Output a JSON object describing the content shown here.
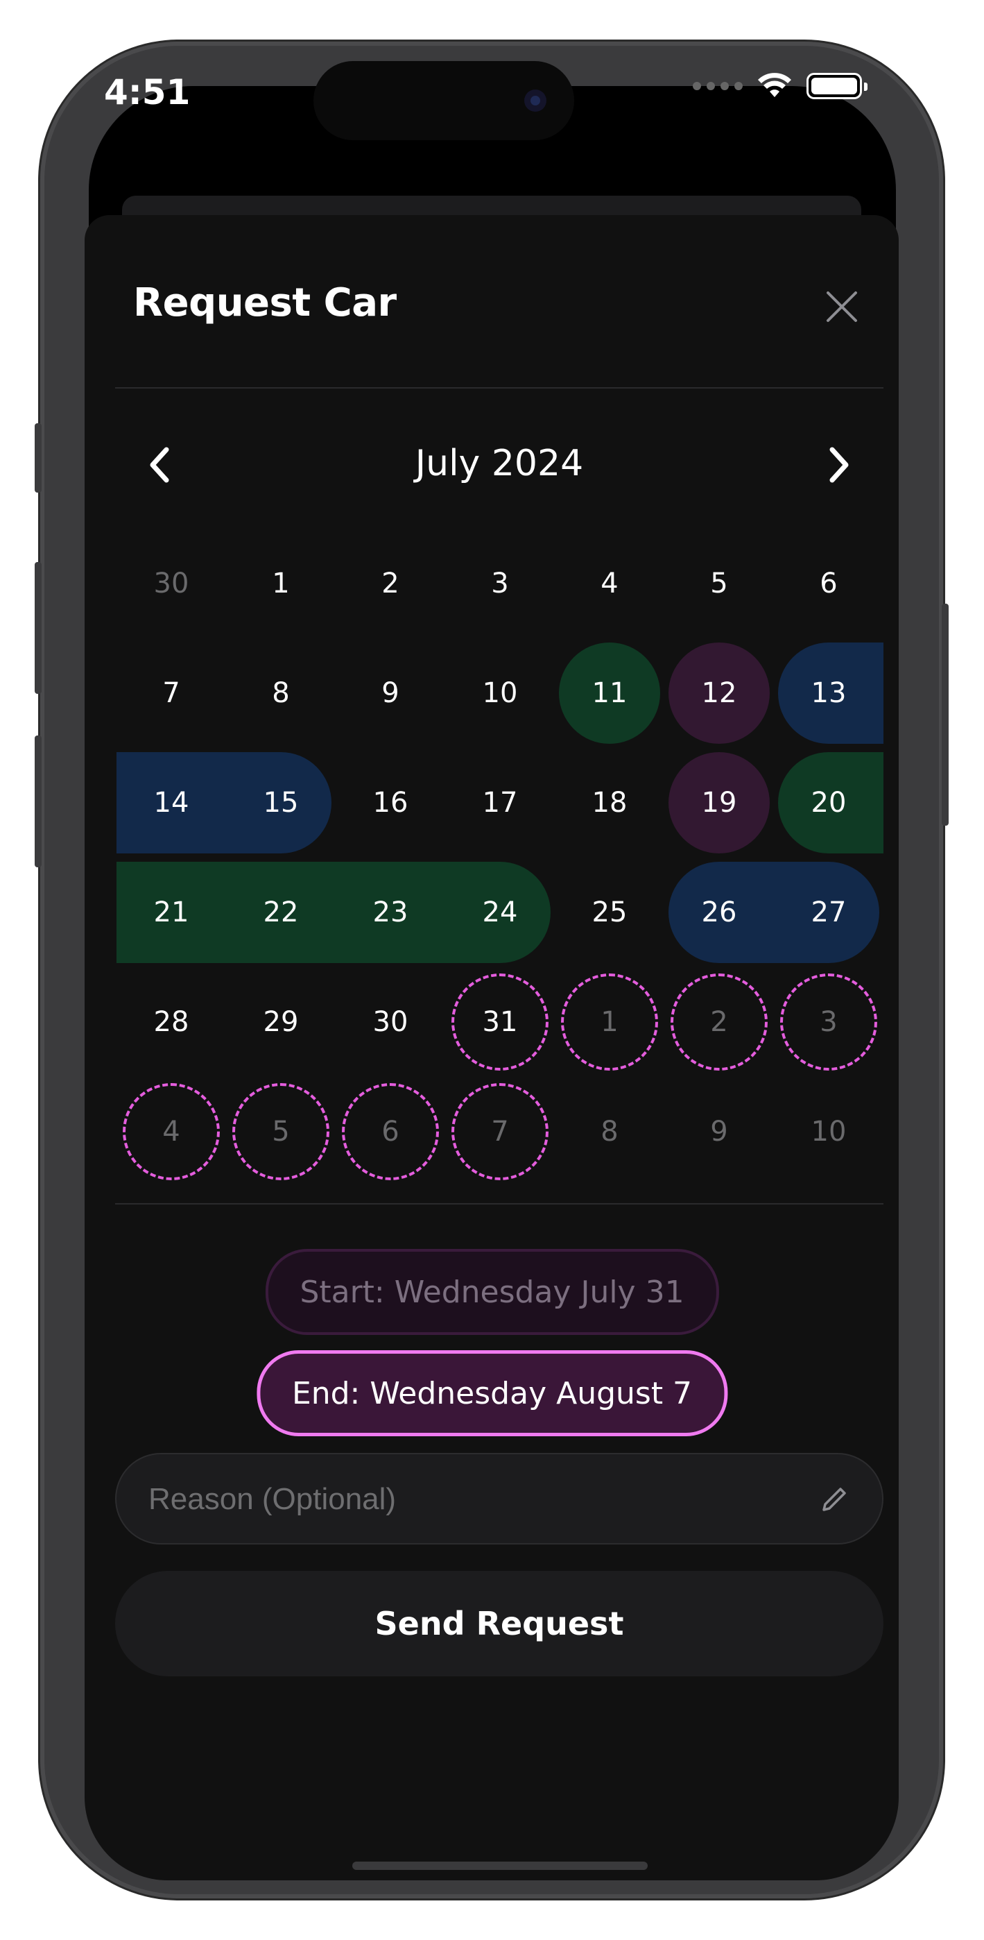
{
  "status_bar": {
    "time": "4:51"
  },
  "sheet": {
    "title": "Request Car",
    "close_icon": "close-icon"
  },
  "calendar": {
    "month_label": "July 2024",
    "prev_icon": "chevron-left-icon",
    "next_icon": "chevron-right-icon",
    "weeks": [
      [
        {
          "d": "30",
          "dim": true
        },
        {
          "d": "1"
        },
        {
          "d": "2"
        },
        {
          "d": "3"
        },
        {
          "d": "4"
        },
        {
          "d": "5"
        },
        {
          "d": "6"
        }
      ],
      [
        {
          "d": "7"
        },
        {
          "d": "8"
        },
        {
          "d": "9"
        },
        {
          "d": "10"
        },
        {
          "d": "11"
        },
        {
          "d": "12"
        },
        {
          "d": "13"
        }
      ],
      [
        {
          "d": "14"
        },
        {
          "d": "15"
        },
        {
          "d": "16"
        },
        {
          "d": "17"
        },
        {
          "d": "18"
        },
        {
          "d": "19"
        },
        {
          "d": "20"
        }
      ],
      [
        {
          "d": "21"
        },
        {
          "d": "22"
        },
        {
          "d": "23"
        },
        {
          "d": "24"
        },
        {
          "d": "25"
        },
        {
          "d": "26"
        },
        {
          "d": "27"
        }
      ],
      [
        {
          "d": "28"
        },
        {
          "d": "29"
        },
        {
          "d": "30"
        },
        {
          "d": "31",
          "sel": true
        },
        {
          "d": "1",
          "dim": true,
          "sel": true
        },
        {
          "d": "2",
          "dim": true,
          "sel": true
        },
        {
          "d": "3",
          "dim": true,
          "sel": true
        }
      ],
      [
        {
          "d": "4",
          "dim": true,
          "sel": true
        },
        {
          "d": "5",
          "dim": true,
          "sel": true
        },
        {
          "d": "6",
          "dim": true,
          "sel": true
        },
        {
          "d": "7",
          "dim": true,
          "sel": true
        },
        {
          "d": "8",
          "dim": true
        },
        {
          "d": "9",
          "dim": true
        },
        {
          "d": "10",
          "dim": true
        }
      ]
    ],
    "bookings": [
      {
        "row": 1,
        "from": 4,
        "to": 4,
        "color": "#0f3a24",
        "shape": "circle"
      },
      {
        "row": 1,
        "from": 5,
        "to": 5,
        "color": "#321831",
        "shape": "circle"
      },
      {
        "row": 1,
        "from": 6,
        "to": 6,
        "color": "#12294a",
        "shape": "open-right"
      },
      {
        "row": 2,
        "from": 0,
        "to": 1,
        "color": "#12294a",
        "shape": "open-left"
      },
      {
        "row": 2,
        "from": 5,
        "to": 5,
        "color": "#321831",
        "shape": "circle"
      },
      {
        "row": 2,
        "from": 6,
        "to": 6,
        "color": "#0f3a24",
        "shape": "open-right"
      },
      {
        "row": 3,
        "from": 0,
        "to": 3,
        "color": "#0f3a24",
        "shape": "open-left"
      },
      {
        "row": 3,
        "from": 5,
        "to": 6,
        "color": "#12294a",
        "shape": "pill"
      }
    ]
  },
  "selection": {
    "start_label": "Start: Wednesday July 31",
    "end_label": "End: Wednesday August 7"
  },
  "reason_field": {
    "value": "",
    "placeholder": "Reason (Optional)",
    "icon": "pencil-icon"
  },
  "send_button": {
    "label": "Send Request"
  },
  "colors": {
    "accent": "#f07af0",
    "booking_green": "#0f3a24",
    "booking_purple": "#321831",
    "booking_blue": "#12294a"
  }
}
